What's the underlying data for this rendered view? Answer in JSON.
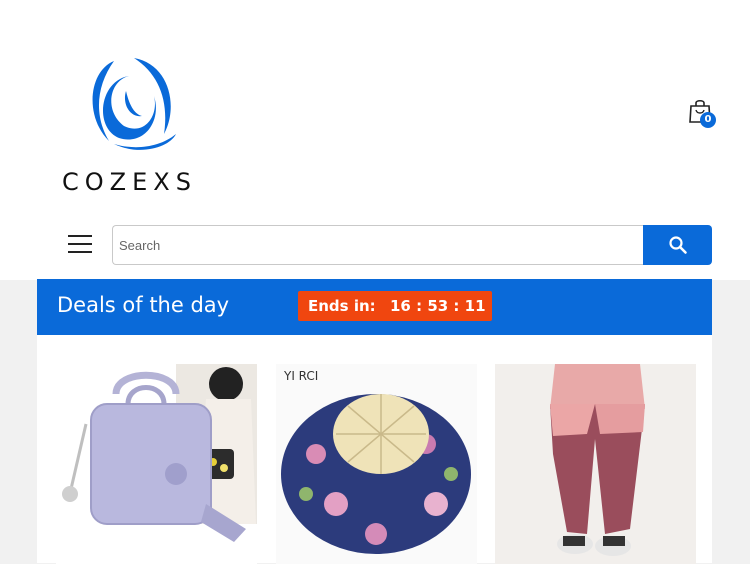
{
  "brand": {
    "name": "COZEXS",
    "color": "#0a6ad9"
  },
  "cart": {
    "count": "0"
  },
  "search": {
    "placeholder": "Search"
  },
  "deals": {
    "title": "Deals of the day",
    "ends_label": "Ends in:",
    "countdown": "16 : 53 : 11"
  },
  "products": [
    {
      "name": "purple handbag",
      "image_text": ""
    },
    {
      "name": "floral bucket hat",
      "image_text": "YI RCI"
    },
    {
      "name": "pink leggings",
      "image_text": ""
    }
  ],
  "colors": {
    "accent": "#0a6ad9",
    "countdown_bg": "#f0460f"
  }
}
